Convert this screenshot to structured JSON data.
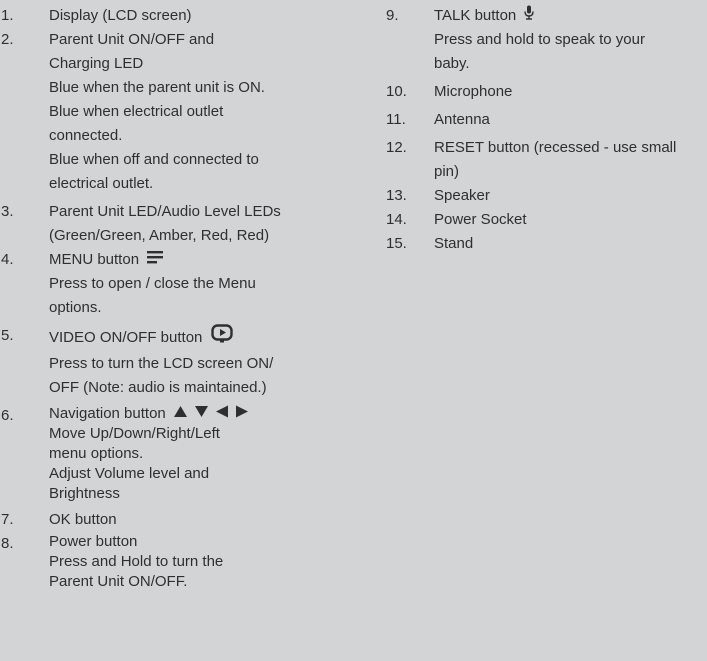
{
  "items": [
    {
      "num": "1.",
      "lines": [
        "Display (LCD screen)"
      ]
    },
    {
      "num": "2.",
      "lines": [
        "Parent Unit ON/OFF and",
        "Charging LED",
        "Blue when the parent unit is ON.",
        "Blue when electrical outlet",
        "connected.",
        "Blue when off and connected to",
        "electrical outlet."
      ]
    },
    {
      "num": "3.",
      "lines": [
        "Parent Unit LED/Audio Level LEDs",
        "(Green/Green, Amber, Red, Red)"
      ]
    },
    {
      "num": "4.",
      "title": "MENU button",
      "icon": "menu-icon",
      "lines": [
        "Press to open / close the Menu",
        "options."
      ]
    },
    {
      "num": "5.",
      "title": "VIDEO ON/OFF button",
      "icon": "video-icon",
      "lines": [
        "Press to turn the LCD screen ON/",
        "OFF (Note: audio is maintained.)"
      ]
    },
    {
      "num": "6.",
      "title": "Navigation button",
      "icon": "arrows-icon",
      "lines": [
        "Move Up/Down/Right/Left",
        "menu options.",
        "Adjust Volume level and",
        "Brightness"
      ]
    },
    {
      "num": "7.",
      "lines": [
        "OK button"
      ]
    },
    {
      "num": "8.",
      "lines": [
        "Power button",
        "Press and Hold to turn the",
        "Parent Unit ON/OFF."
      ]
    },
    {
      "num": "9.",
      "title": "TALK button",
      "icon": "microphone-icon",
      "lines": [
        "Press and hold to speak to your",
        "baby."
      ]
    },
    {
      "num": "10.",
      "lines": [
        "Microphone"
      ]
    },
    {
      "num": "11.",
      "lines": [
        "Antenna"
      ]
    },
    {
      "num": "12.",
      "lines": [
        "RESET button (recessed - use small",
        "pin)"
      ]
    },
    {
      "num": "13.",
      "lines": [
        "Speaker"
      ]
    },
    {
      "num": "14.",
      "lines": [
        "Power Socket"
      ]
    },
    {
      "num": "15.",
      "lines": [
        "Stand"
      ]
    }
  ]
}
